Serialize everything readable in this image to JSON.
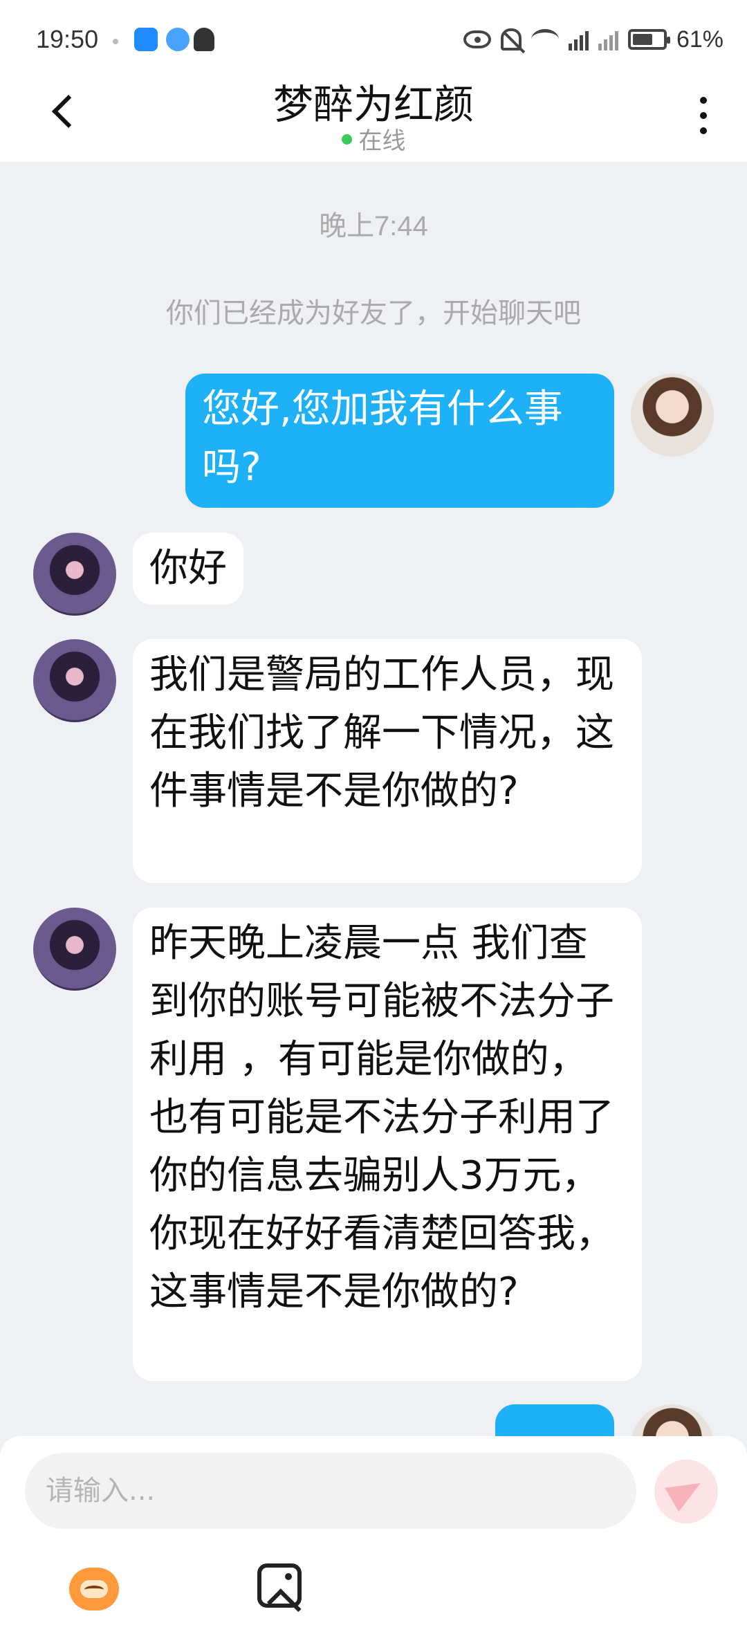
{
  "status_bar": {
    "time": "19:50",
    "battery": "61%"
  },
  "header": {
    "title": "梦醉为红颜",
    "status": "在线"
  },
  "chat": {
    "time_separator": "晚上7:44",
    "system_message": "你们已经成为好友了，开始聊天吧",
    "messages": [
      {
        "sender": "me",
        "text": "您好,您加我有什么事吗?"
      },
      {
        "sender": "them",
        "text": "你好"
      },
      {
        "sender": "them",
        "text": "我们是警局的工作人员，现在我们找了解一下情况，这件事情是不是你做的?"
      },
      {
        "sender": "them",
        "text": "昨天晚上凌晨一点 我们查到你的账号可能被不法分子利用 ，有可能是你做的，也有可能是不法分子利用了你的信息去骗别人3万元，你现在好好看清楚回答我，这事情是不是你做的?"
      }
    ]
  },
  "composer": {
    "placeholder": "请输入..."
  },
  "colors": {
    "my_bubble": "#1eb1f8",
    "their_bubble": "#ffffff",
    "background": "#eef0f4",
    "online_dot": "#3ac95a"
  }
}
